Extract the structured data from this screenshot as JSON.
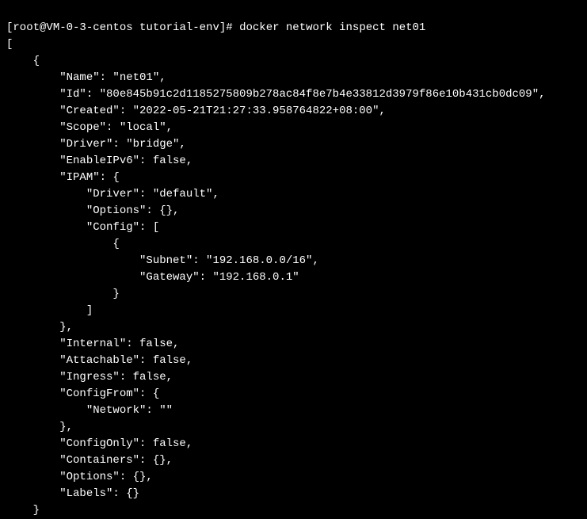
{
  "prompt": {
    "user": "root",
    "host": "VM-0-3-centos",
    "dir": "tutorial-env",
    "symbol": "#",
    "command": "docker network inspect net01"
  },
  "output": {
    "open_bracket": "[",
    "open_brace": "    {",
    "name_line": "        \"Name\": \"net01\",",
    "id_line": "        \"Id\": \"80e845b91c2d1185275809b278ac84f8e7b4e33812d3979f86e10b431cb0dc09\",",
    "created_line": "        \"Created\": \"2022-05-21T21:27:33.958764822+08:00\",",
    "scope_line": "        \"Scope\": \"local\",",
    "driver_line": "        \"Driver\": \"bridge\",",
    "enableipv6_line": "        \"EnableIPv6\": false,",
    "ipam_open": "        \"IPAM\": {",
    "ipam_driver": "            \"Driver\": \"default\",",
    "ipam_options": "            \"Options\": {},",
    "ipam_config_open": "            \"Config\": [",
    "ipam_config_brace_open": "                {",
    "ipam_subnet": "                    \"Subnet\": \"192.168.0.0/16\",",
    "ipam_gateway": "                    \"Gateway\": \"192.168.0.1\"",
    "ipam_config_brace_close": "                }",
    "ipam_config_close": "            ]",
    "ipam_close": "        },",
    "internal_line": "        \"Internal\": false,",
    "attachable_line": "        \"Attachable\": false,",
    "ingress_line": "        \"Ingress\": false,",
    "configfrom_open": "        \"ConfigFrom\": {",
    "configfrom_network": "            \"Network\": \"\"",
    "configfrom_close": "        },",
    "configonly_line": "        \"ConfigOnly\": false,",
    "containers_line": "        \"Containers\": {},",
    "options_line": "        \"Options\": {},",
    "labels_line": "        \"Labels\": {}",
    "close_brace": "    }"
  }
}
